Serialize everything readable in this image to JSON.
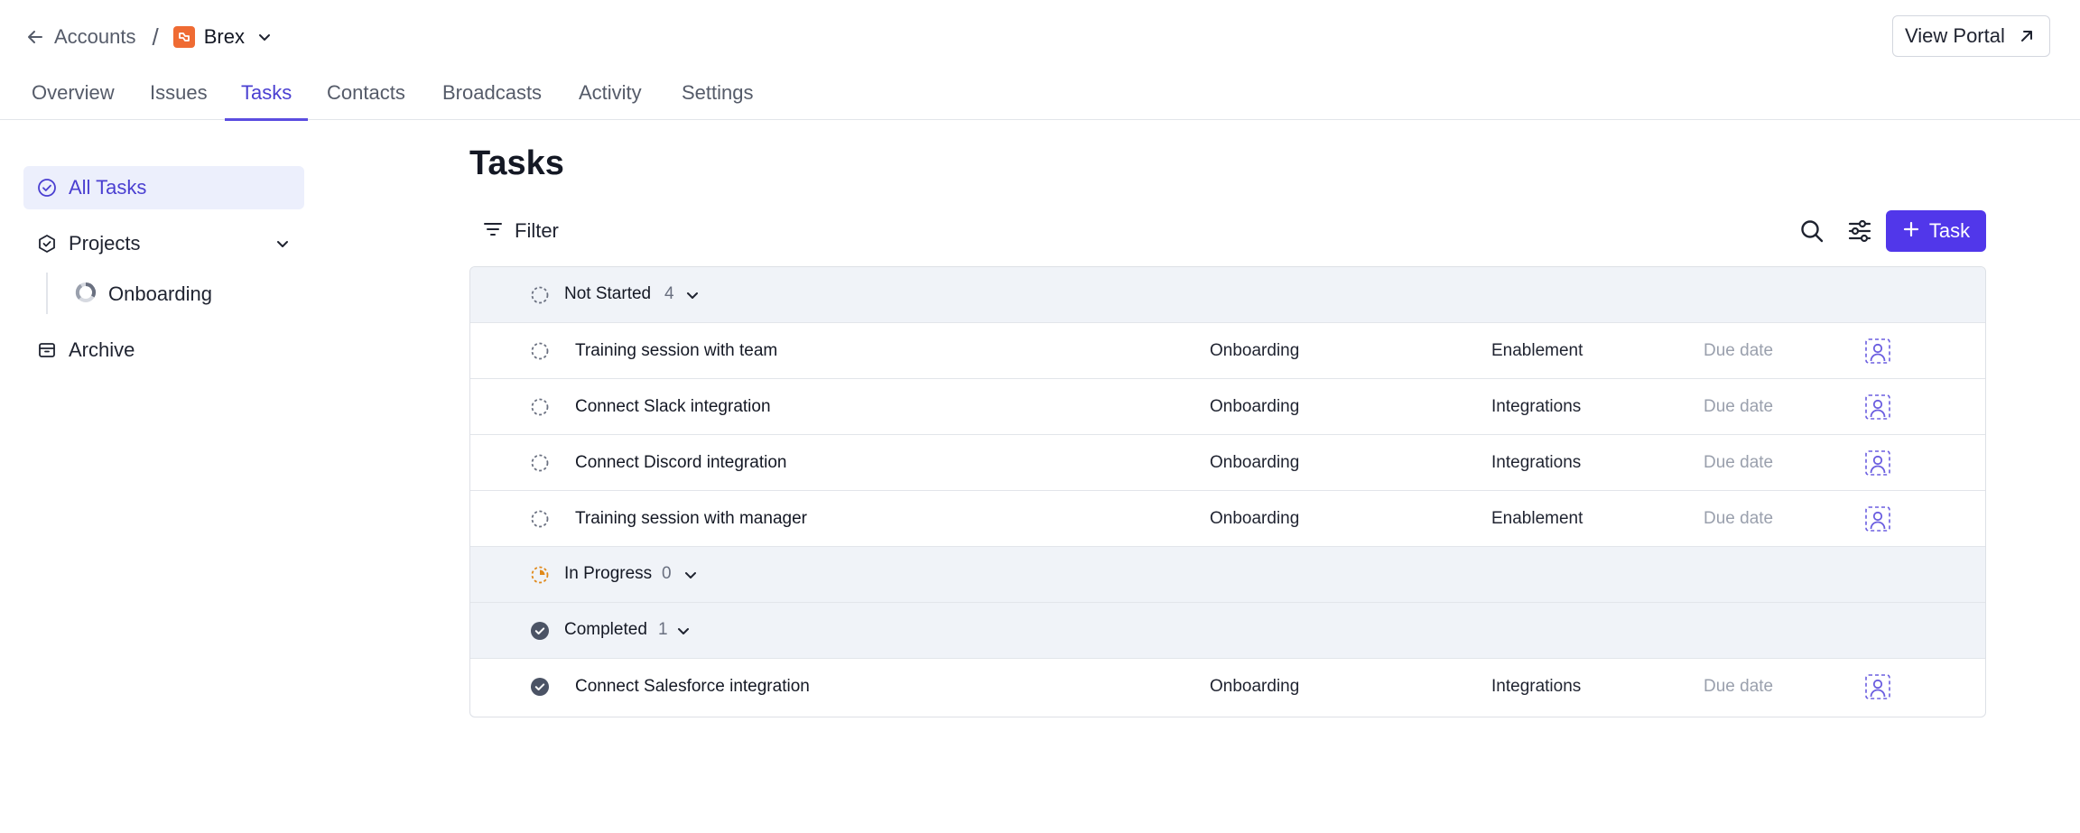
{
  "header": {
    "breadcrumb_parent": "Accounts",
    "breadcrumb_separator": "/",
    "account_name": "Brex",
    "view_portal_label": "View Portal"
  },
  "tabs": [
    {
      "label": "Overview",
      "active": false
    },
    {
      "label": "Issues",
      "active": false
    },
    {
      "label": "Tasks",
      "active": true
    },
    {
      "label": "Contacts",
      "active": false
    },
    {
      "label": "Broadcasts",
      "active": false
    },
    {
      "label": "Activity",
      "active": false
    },
    {
      "label": "Settings",
      "active": false
    }
  ],
  "sidebar": {
    "all_tasks": "All Tasks",
    "projects": "Projects",
    "project_items": [
      "Onboarding"
    ],
    "archive": "Archive"
  },
  "main": {
    "title": "Tasks",
    "filter_label": "Filter",
    "add_task_label": "Task"
  },
  "groups": [
    {
      "label": "Not Started",
      "count": "4",
      "status": "not-started",
      "tasks": [
        {
          "name": "Training session with team",
          "project": "Onboarding",
          "tag": "Enablement",
          "due": "Due date"
        },
        {
          "name": "Connect Slack integration",
          "project": "Onboarding",
          "tag": "Integrations",
          "due": "Due date"
        },
        {
          "name": "Connect Discord integration",
          "project": "Onboarding",
          "tag": "Integrations",
          "due": "Due date"
        },
        {
          "name": "Training session with manager",
          "project": "Onboarding",
          "tag": "Enablement",
          "due": "Due date"
        }
      ]
    },
    {
      "label": "In Progress",
      "count": "0",
      "status": "in-progress",
      "tasks": []
    },
    {
      "label": "Completed",
      "count": "1",
      "status": "completed",
      "tasks": [
        {
          "name": "Connect Salesforce integration",
          "project": "Onboarding",
          "tag": "Integrations",
          "due": "Due date"
        }
      ]
    }
  ],
  "colors": {
    "accent": "#5137ea",
    "active_tab": "#4a3fd1",
    "brand_logo": "#ef6b33",
    "group_background": "#f0f3f8",
    "in_progress": "#e0891b",
    "completed": "#4b5365"
  }
}
